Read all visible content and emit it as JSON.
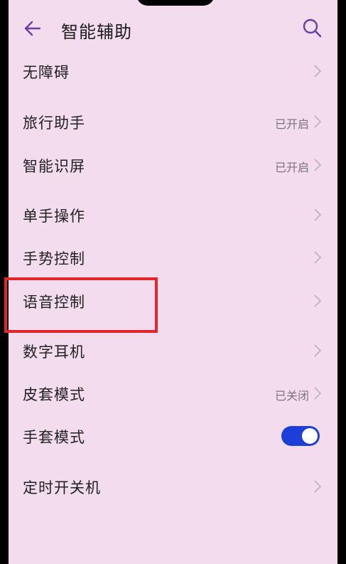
{
  "header": {
    "title": "智能辅助",
    "back_icon": "arrow-left-icon",
    "search_icon": "search-icon"
  },
  "colors": {
    "background": "#f2dcee",
    "accent": "#1d3fd9",
    "highlight_box": "#e2262d",
    "secondary_text": "#7a7380"
  },
  "items": [
    {
      "label": "无障碍",
      "status": ""
    },
    {
      "label": "旅行助手",
      "status": "已开启"
    },
    {
      "label": "智能识屏",
      "status": "已开启"
    },
    {
      "label": "单手操作",
      "status": ""
    },
    {
      "label": "手势控制",
      "status": ""
    },
    {
      "label": "语音控制",
      "status": ""
    },
    {
      "label": "数字耳机",
      "status": ""
    },
    {
      "label": "皮套模式",
      "status": "已关闭"
    },
    {
      "label": "手套模式",
      "toggle_on": true
    },
    {
      "label": "定时开关机",
      "status": ""
    }
  ]
}
